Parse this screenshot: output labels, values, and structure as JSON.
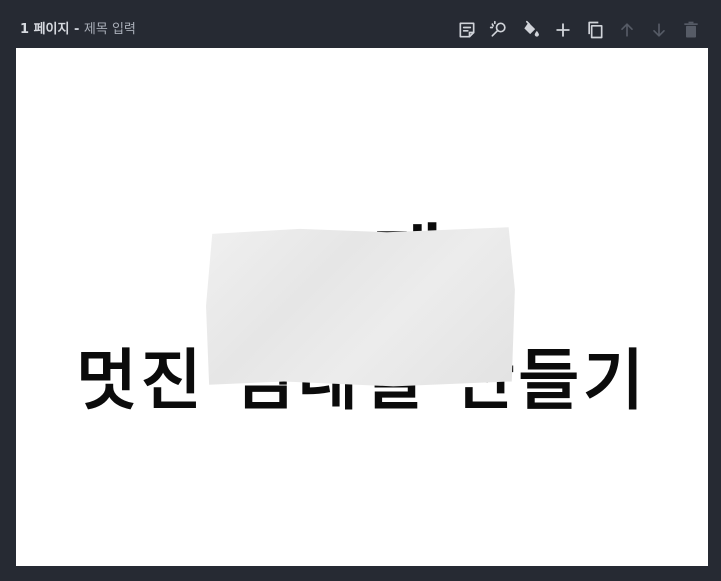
{
  "header": {
    "page_number": "1 페이지",
    "separator": " - ",
    "title_placeholder": "제목 입력"
  },
  "toolbar": [
    {
      "name": "note-icon-button",
      "icon": "note-icon",
      "enabled": true
    },
    {
      "name": "search-replace-icon-button",
      "icon": "magic-search-icon",
      "enabled": true
    },
    {
      "name": "fill-color-icon-button",
      "icon": "paint-bucket-icon",
      "enabled": true
    },
    {
      "name": "add-page-button",
      "icon": "plus-icon",
      "enabled": true
    },
    {
      "name": "duplicate-page-button",
      "icon": "copy-icon",
      "enabled": true
    },
    {
      "name": "move-up-button",
      "icon": "arrow-up-icon",
      "enabled": false
    },
    {
      "name": "move-down-button",
      "icon": "arrow-down-icon",
      "enabled": false
    },
    {
      "name": "delete-page-button",
      "icon": "trash-icon",
      "enabled": false
    }
  ],
  "canvas": {
    "line1": "E         게",
    "line2": "멋진 썸네일 만들기"
  },
  "colors": {
    "background": "#262a33",
    "canvas": "#ffffff",
    "icon_enabled": "#d0d3d9",
    "icon_disabled": "#565b66",
    "text": "#0b0b0b"
  }
}
